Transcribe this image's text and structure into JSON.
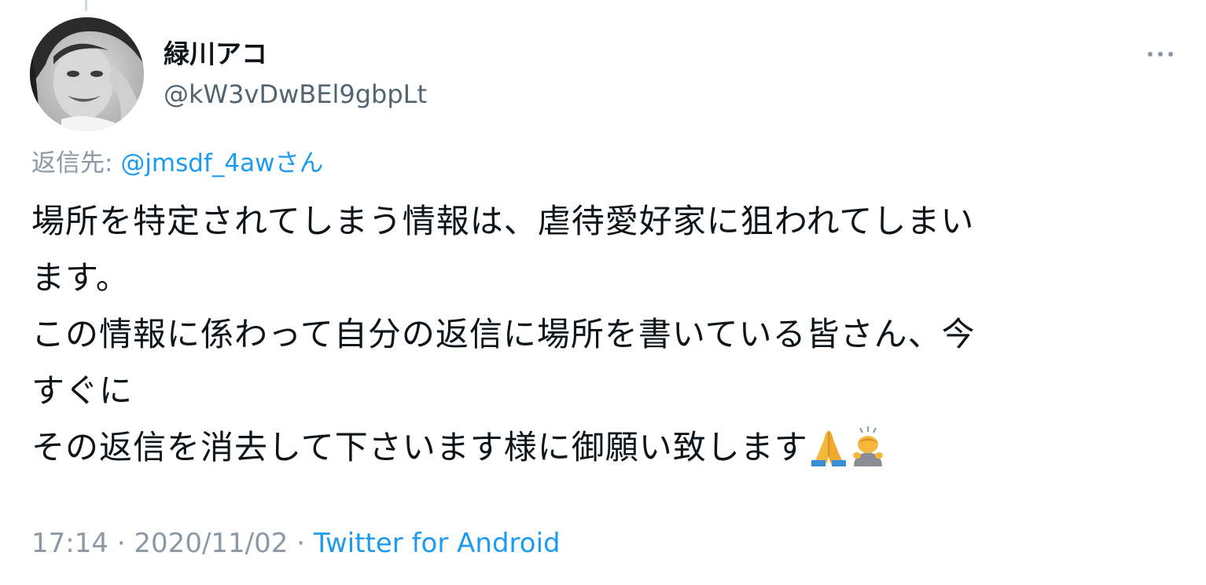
{
  "user": {
    "display_name": "緑川アコ",
    "handle": "@kW3vDwBEl9gbpLt"
  },
  "reply": {
    "prefix": "返信先: ",
    "mention": "@jmsdf_4aw",
    "suffix": "さん"
  },
  "tweet": {
    "lines": [
      "場所を特定されてしまう情報は、虐待愛好家に狙われてしまい",
      "ます。",
      "この情報に係わって自分の返信に場所を書いている皆さん、今",
      "すぐに",
      "その返信を消去して下さいます様に御願い致します"
    ],
    "emojis": [
      "folded-hands-emoji",
      "bowing-person-emoji"
    ]
  },
  "meta": {
    "time": "17:14",
    "separator": " · ",
    "date": "2020/11/02",
    "source": "Twitter for Android"
  },
  "icons": {
    "more": "more-horizontal-icon"
  },
  "colors": {
    "text": "#0f1419",
    "secondary": "#536471",
    "muted": "#8b98a5",
    "link": "#1d9bf0"
  }
}
